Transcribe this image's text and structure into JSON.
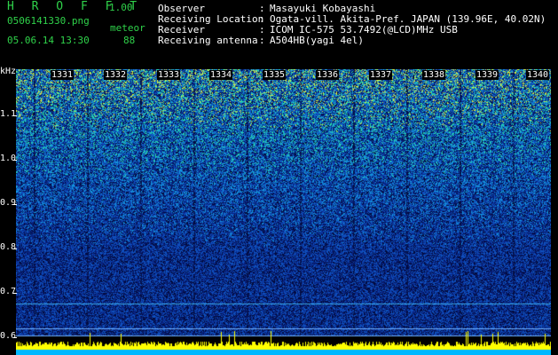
{
  "header": {
    "app_title": "H R O F F T",
    "app_version": "1.00",
    "file_name": "0506141330.png",
    "datetime": "05.06.14 13:30",
    "meteor_label": "meteor",
    "meteor_count": "88"
  },
  "info": [
    {
      "label": "Observer",
      "value": "Masayuki Kobayashi"
    },
    {
      "label": "Receiving Location",
      "value": "Ogata-vill. Akita-Pref. JAPAN (139.96E, 40.02N)"
    },
    {
      "label": "Receiver",
      "value": "ICOM IC-575 53.7492(@LCD)MHz USB"
    },
    {
      "label": "Receiving antenna",
      "value": "A504HB(yagi 4el)"
    }
  ],
  "separator": ":",
  "y_axis": {
    "unit": "kHz",
    "ticks": [
      "1.1",
      "1.0",
      "0.9",
      "0.8",
      "0.7",
      "0.6"
    ]
  },
  "x_axis": {
    "minutes": [
      "1331",
      "1332",
      "1333",
      "1334",
      "1335",
      "1336",
      "1337",
      "1338",
      "1339",
      "1340"
    ]
  },
  "colors": {
    "background": "#000000",
    "header_green": "#2fd24a",
    "header_white": "#ffffff",
    "spectrogram_low": "#0b1a7a",
    "spectrogram_mid": "#1f6fd0",
    "spectrogram_high": "#2fe0b0",
    "signal_peak": "#ffff00"
  }
}
